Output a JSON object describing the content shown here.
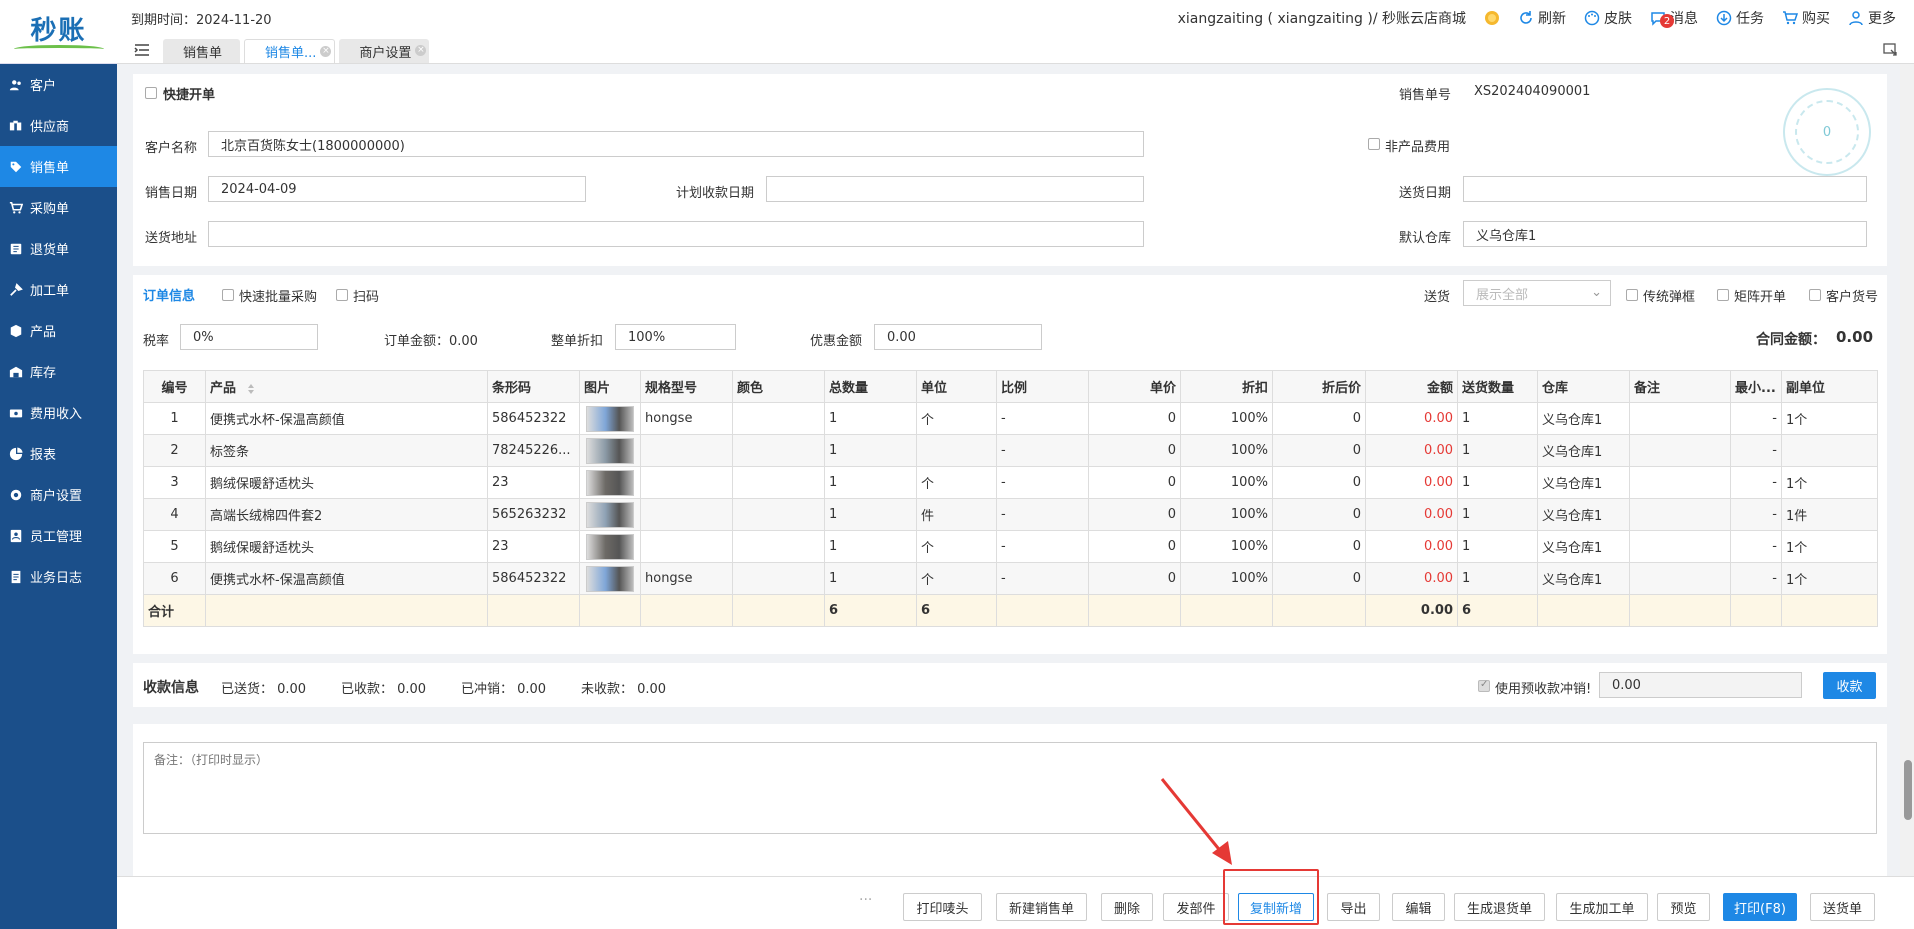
{
  "brand": {
    "logo_text": "秒账"
  },
  "sidebar": {
    "items": [
      {
        "label": "客户",
        "icon": "users-icon"
      },
      {
        "label": "供应商",
        "icon": "supplier-icon"
      },
      {
        "label": "销售单",
        "icon": "tag-icon",
        "active": true
      },
      {
        "label": "采购单",
        "icon": "cart-icon"
      },
      {
        "label": "退货单",
        "icon": "return-icon"
      },
      {
        "label": "加工单",
        "icon": "tools-icon"
      },
      {
        "label": "产品",
        "icon": "box-icon"
      },
      {
        "label": "库存",
        "icon": "warehouse-icon"
      },
      {
        "label": "费用收入",
        "icon": "money-icon"
      },
      {
        "label": "报表",
        "icon": "pie-chart-icon"
      },
      {
        "label": "商户设置",
        "icon": "settings-icon"
      },
      {
        "label": "员工管理",
        "icon": "staff-icon"
      },
      {
        "label": "业务日志",
        "icon": "log-icon"
      }
    ]
  },
  "topbar": {
    "expire": "到期时间：2024-11-20",
    "account": "xiangzaiting ( xiangzaiting )/ 秒账云店商城",
    "refresh": "刷新",
    "skin": "皮肤",
    "messages": "消息",
    "messages_badge": "2",
    "tasks": "任务",
    "buy": "购买",
    "more": "更多"
  },
  "tabs": [
    {
      "label": "销售单"
    },
    {
      "label": "销售单..."
    },
    {
      "label": "商户设置"
    }
  ],
  "header": {
    "quick_label": "快捷开单",
    "order_no_label": "销售单号",
    "order_no": "XS202404090001",
    "stamp_value": "0",
    "customer_label": "客户名称",
    "customer": "北京百货陈女士(1800000000)",
    "non_product_label": "非产品费用",
    "sale_date_label": "销售日期",
    "sale_date": "2024-04-09",
    "plan_date_label": "计划收款日期",
    "plan_date": "",
    "delivery_date_label": "送货日期",
    "delivery_date": "",
    "address_label": "送货地址",
    "address": "",
    "warehouse_label": "默认仓库",
    "warehouse": "义乌仓库1"
  },
  "order": {
    "title": "订单信息",
    "batch_label": "快速批量采购",
    "scan_label": "扫码",
    "delivery_label": "送货",
    "delivery_placeholder": "展示全部",
    "traditional_label": "传统弹框",
    "matrix_label": "矩阵开单",
    "customer_no_label": "客户货号",
    "tax_label": "税率",
    "tax": "0%",
    "amount_label": "订单金额：0.00",
    "discount_label": "整单折扣",
    "discount": "100%",
    "promo_label": "优惠金额",
    "promo": "0.00",
    "contract_label": "合同金额：",
    "contract": "0.00",
    "columns": [
      "编号",
      "产品",
      "条形码",
      "图片",
      "规格型号",
      "颜色",
      "总数量",
      "单位",
      "比例",
      "单价",
      "折扣",
      "折后价",
      "金额",
      "送货数量",
      "仓库",
      "备注",
      "最小...",
      "副单位"
    ],
    "rows": [
      {
        "no": "1",
        "product": "便携式水杯-保温高颜值",
        "barcode": "586452322",
        "spec": "hongse",
        "color": "",
        "qty": "1",
        "unit": "个",
        "ratio": "-",
        "price": "0",
        "disc": "100%",
        "after": "0",
        "amount": "0.00",
        "dqty": "1",
        "wh": "义乌仓库1",
        "note": "",
        "min": "-",
        "sub": "1个",
        "thumb": "#7fa6d8"
      },
      {
        "no": "2",
        "product": "标签条",
        "barcode": "78245226...",
        "spec": "",
        "color": "",
        "qty": "1",
        "unit": "",
        "ratio": "-",
        "price": "0",
        "disc": "100%",
        "after": "0",
        "amount": "0.00",
        "dqty": "1",
        "wh": "义乌仓库1",
        "note": "",
        "min": "-",
        "sub": "",
        "thumb": "#8b9aa6"
      },
      {
        "no": "3",
        "product": "鹅绒保暖舒适枕头",
        "barcode": "23",
        "spec": "",
        "color": "",
        "qty": "1",
        "unit": "个",
        "ratio": "-",
        "price": "0",
        "disc": "100%",
        "after": "0",
        "amount": "0.00",
        "dqty": "1",
        "wh": "义乌仓库1",
        "note": "",
        "min": "-",
        "sub": "1个",
        "thumb": "#6d6a66"
      },
      {
        "no": "4",
        "product": "高端长绒棉四件套2",
        "barcode": "565263232",
        "spec": "",
        "color": "",
        "qty": "1",
        "unit": "件",
        "ratio": "-",
        "price": "0",
        "disc": "100%",
        "after": "0",
        "amount": "0.00",
        "dqty": "1",
        "wh": "义乌仓库1",
        "note": "",
        "min": "-",
        "sub": "1件",
        "thumb": "#8fa2b5"
      },
      {
        "no": "5",
        "product": "鹅绒保暖舒适枕头",
        "barcode": "23",
        "spec": "",
        "color": "",
        "qty": "1",
        "unit": "个",
        "ratio": "-",
        "price": "0",
        "disc": "100%",
        "after": "0",
        "amount": "0.00",
        "dqty": "1",
        "wh": "义乌仓库1",
        "note": "",
        "min": "-",
        "sub": "1个",
        "thumb": "#6d6a66"
      },
      {
        "no": "6",
        "product": "便携式水杯-保温高颜值",
        "barcode": "586452322",
        "spec": "hongse",
        "color": "",
        "qty": "1",
        "unit": "个",
        "ratio": "-",
        "price": "0",
        "disc": "100%",
        "after": "0",
        "amount": "0.00",
        "dqty": "1",
        "wh": "义乌仓库1",
        "note": "",
        "min": "-",
        "sub": "1个",
        "thumb": "#7fa6d8"
      }
    ],
    "total": {
      "label": "合计",
      "qty": "6",
      "unit": "6",
      "amount": "0.00",
      "dqty": "6"
    }
  },
  "payment": {
    "title": "收款信息",
    "sent": "已送货：  0.00",
    "received": "已收款：  0.00",
    "offset": "已冲销：  0.00",
    "unpaid": "未收款：  0.00",
    "prepay_label": "使用预收款冲销!",
    "prepay_value": "0.00",
    "collect_button": "收款"
  },
  "note": {
    "placeholder": "备注：（打印时显示）"
  },
  "actions": {
    "more": "···",
    "print_header": "打印唛头",
    "new_order": "新建销售单",
    "delete": "删除",
    "ship": "发部件",
    "copy_new": "复制新增",
    "export": "导出",
    "edit": "编辑",
    "gen_return": "生成退货单",
    "gen_process": "生成加工单",
    "preview": "预览",
    "print": "打印(F8)",
    "delivery": "送货单"
  }
}
